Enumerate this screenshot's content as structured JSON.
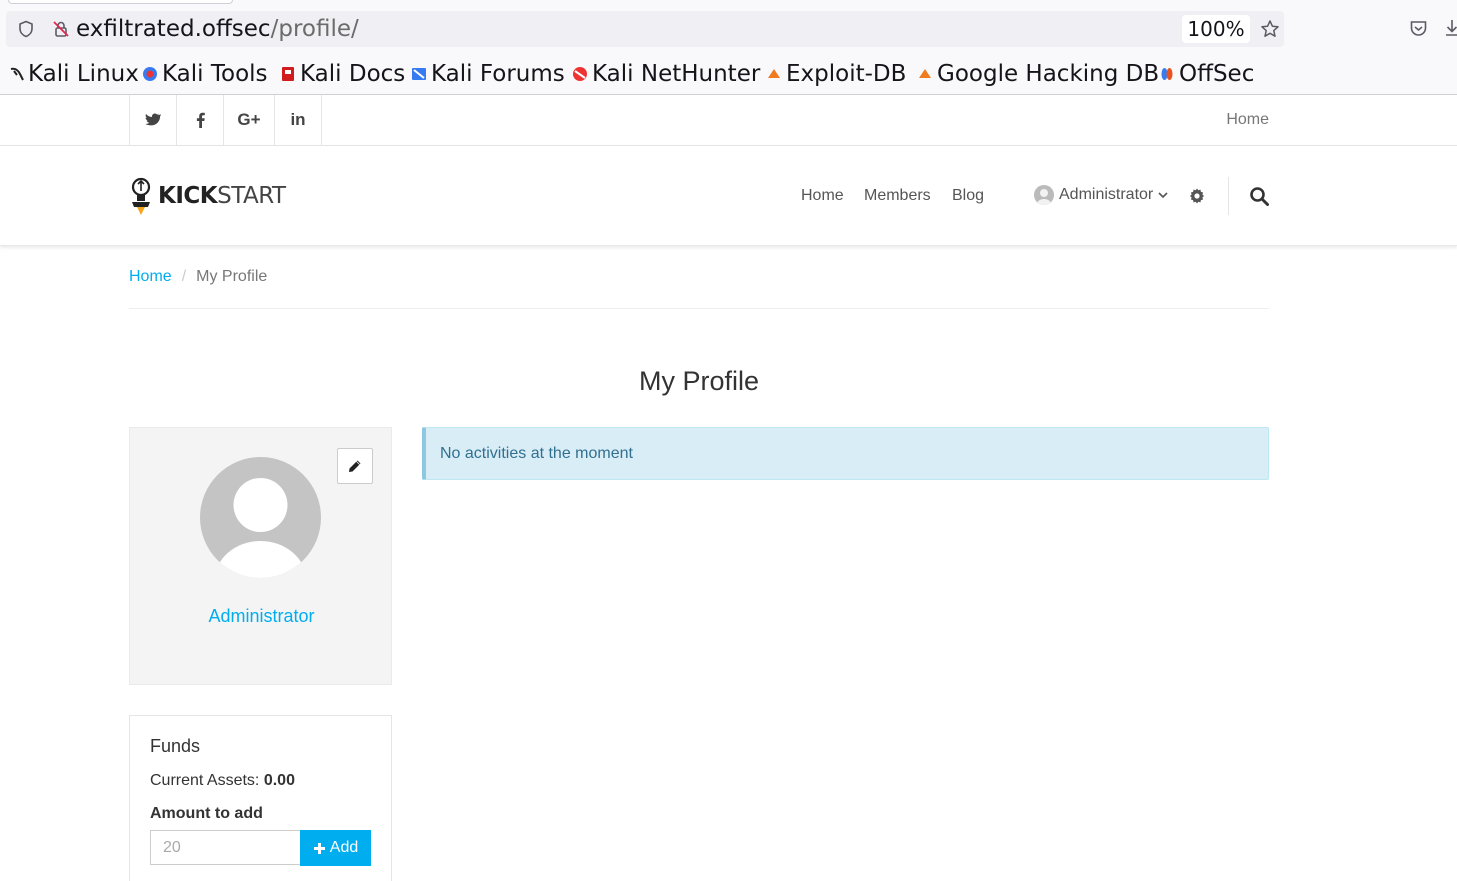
{
  "browser": {
    "url_host": "exfiltrated.offsec",
    "url_path": "/profile/",
    "zoom": "100%",
    "bookmarks": [
      "Kali Linux",
      "Kali Tools",
      "Kali Docs",
      "Kali Forums",
      "Kali NetHunter",
      "Exploit-DB",
      "Google Hacking DB",
      "OffSec"
    ]
  },
  "topbar": {
    "social": [
      "twitter-icon",
      "facebook-icon",
      "google-plus-icon",
      "linkedin-icon"
    ],
    "home": "Home"
  },
  "header": {
    "logo_bold": "KICK",
    "logo_light": "START",
    "nav": [
      "Home",
      "Members",
      "Blog"
    ],
    "user": "Administrator"
  },
  "breadcrumb": {
    "home": "Home",
    "sep": "/",
    "current": "My Profile"
  },
  "page": {
    "title": "My Profile",
    "username": "Administrator",
    "alert": "No activities at the moment"
  },
  "funds": {
    "title": "Funds",
    "assets_label": "Current Assets:",
    "assets_value": "0.00",
    "amount_label": "Amount to add",
    "amount_placeholder": "20",
    "add_label": "Add"
  },
  "colors": {
    "accent": "#00aeef",
    "alert_bg": "#d9edf7",
    "alert_text": "#31708f"
  }
}
